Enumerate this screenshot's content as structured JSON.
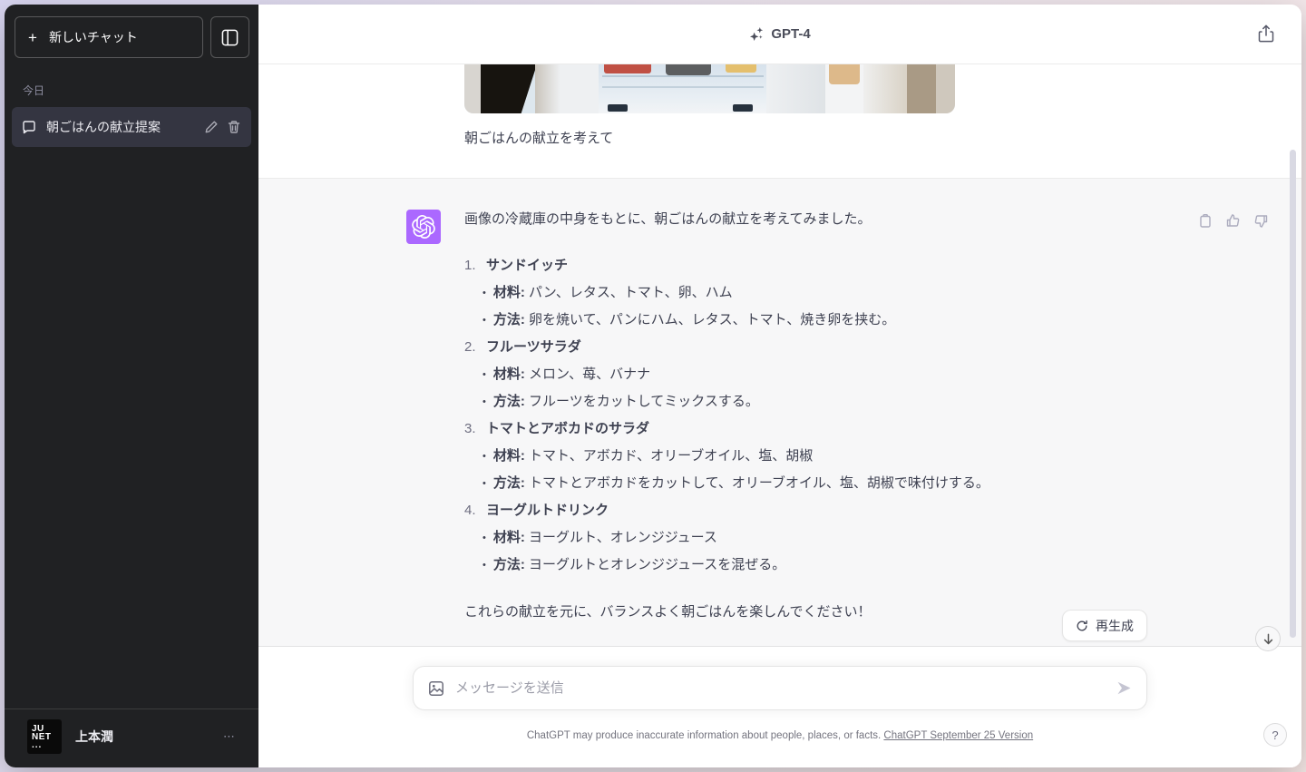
{
  "colors": {
    "sidebar_bg": "#202123",
    "sidebar_active_item_bg": "#343541",
    "assistant_section_bg": "#f7f7f8",
    "assistant_avatar_purple": "#ab68ff",
    "main_text": "#3f4252",
    "muted_text": "#8e8ea0"
  },
  "icons": {
    "plus-icon": "+",
    "bullet-dot": "•",
    "ellipsis-menu-icon": "⋯",
    "question-icon": "?"
  },
  "sidebar": {
    "new_chat_label": "新しいチャット",
    "today_label": "今日",
    "chat_items": [
      {
        "title": "朝ごはんの献立提案"
      }
    ],
    "user": {
      "name": "上本潤",
      "avatar_lines": [
        "JU",
        "NET",
        "..."
      ],
      "menu_glyph": "⋯"
    }
  },
  "header": {
    "model_label": "GPT-4"
  },
  "conversation": {
    "user_message": {
      "text": "朝ごはんの献立を考えて"
    },
    "assistant_message": {
      "intro": "画像の冷蔵庫の中身をもとに、朝ごはんの献立を考えてみました。",
      "items": [
        {
          "num": "1.",
          "title": "サンドイッチ",
          "bullets": [
            {
              "label": "材料:",
              "text": "パン、レタス、トマト、卵、ハム"
            },
            {
              "label": "方法:",
              "text": "卵を焼いて、パンにハム、レタス、トマト、焼き卵を挟む。"
            }
          ]
        },
        {
          "num": "2.",
          "title": "フルーツサラダ",
          "bullets": [
            {
              "label": "材料:",
              "text": "メロン、苺、バナナ"
            },
            {
              "label": "方法:",
              "text": "フルーツをカットしてミックスする。"
            }
          ]
        },
        {
          "num": "3.",
          "title": "トマトとアボカドのサラダ",
          "bullets": [
            {
              "label": "材料:",
              "text": "トマト、アボカド、オリーブオイル、塩、胡椒"
            },
            {
              "label": "方法:",
              "text": "トマトとアボカドをカットして、オリーブオイル、塩、胡椒で味付けする。"
            }
          ]
        },
        {
          "num": "4.",
          "title": "ヨーグルトドリンク",
          "bullets": [
            {
              "label": "材料:",
              "text": "ヨーグルト、オレンジジュース"
            },
            {
              "label": "方法:",
              "text": "ヨーグルトとオレンジジュースを混ぜる。"
            }
          ]
        }
      ],
      "closing": "これらの献立を元に、バランスよく朝ごはんを楽しんでください！"
    },
    "regenerate_label": "再生成"
  },
  "composer": {
    "placeholder": "メッセージを送信"
  },
  "footer": {
    "disclaimer": "ChatGPT may produce inaccurate information about people, places, or facts. ",
    "version_link": "ChatGPT September 25 Version",
    "help_label": "?"
  }
}
